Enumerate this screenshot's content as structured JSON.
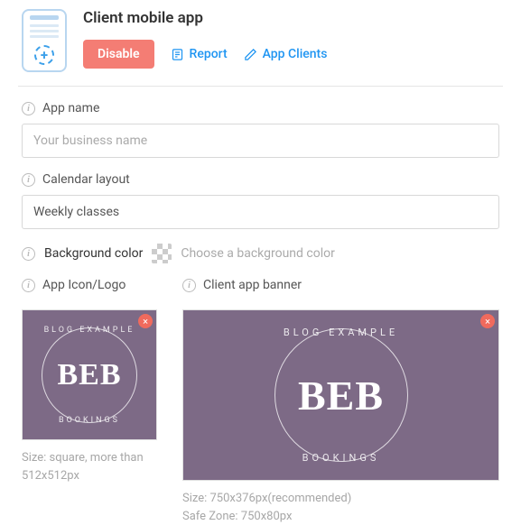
{
  "header": {
    "title": "Client mobile app",
    "disable_label": "Disable",
    "report_label": "Report",
    "app_clients_label": "App Clients"
  },
  "fields": {
    "app_name": {
      "label": "App name",
      "placeholder": "Your business name",
      "value": ""
    },
    "calendar_layout": {
      "label": "Calendar layout",
      "value": "Weekly classes"
    },
    "bg_color": {
      "label": "Background color",
      "hint": "Choose a background color"
    },
    "app_icon": {
      "label": "App Icon/Logo",
      "hint": "Size: square, more than 512x512px"
    },
    "banner": {
      "label": "Client app banner",
      "hint_line1": "Size: 750x376px(recommended)",
      "hint_line2": "Safe Zone: 750x80px"
    }
  },
  "logo": {
    "center": "BEB",
    "top_text": "BLOG EXAMPLE",
    "bottom_text": "BOOKINGS"
  },
  "glyphs": {
    "remove": "×",
    "plus": "+"
  }
}
